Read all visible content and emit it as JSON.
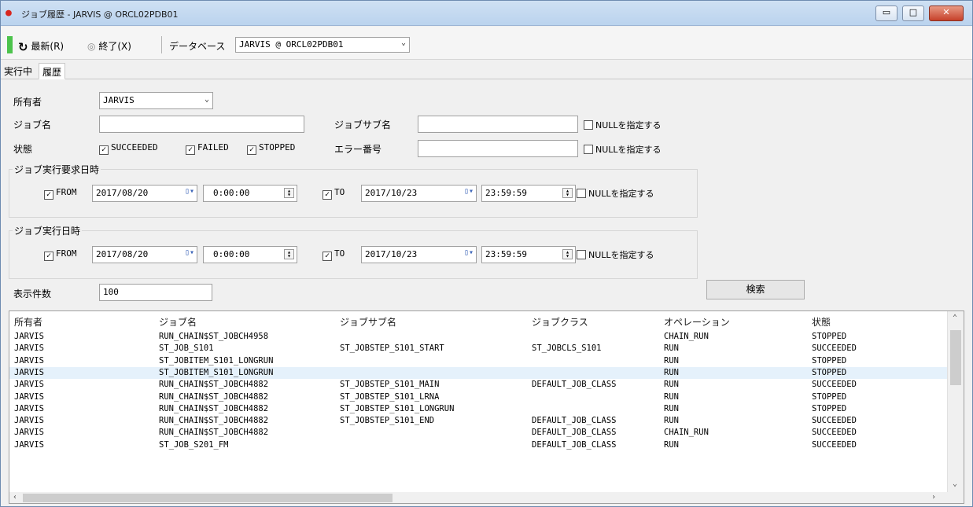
{
  "window": {
    "title": "ジョブ履歴 - JARVIS @ ORCL02PDB01",
    "min_label": "▭",
    "max_label": "□",
    "close_label": "✕"
  },
  "toolbar": {
    "refresh_label": "最新(R)",
    "exit_label": "終了(X)",
    "database_label": "データベース",
    "database_value": "JARVIS @ ORCL02PDB01"
  },
  "tabs": [
    "実行中",
    "履歴"
  ],
  "filters": {
    "owner_label": "所有者",
    "owner_value": "JARVIS",
    "job_name_label": "ジョブ名",
    "job_name_value": "",
    "job_subname_label": "ジョブサブ名",
    "job_subname_value": "",
    "null_label": "NULLを指定する",
    "status_label": "状態",
    "status_options": [
      {
        "label": "SUCCEEDED",
        "checked": true
      },
      {
        "label": "FAILED",
        "checked": true
      },
      {
        "label": "STOPPED",
        "checked": true
      }
    ],
    "error_no_label": "エラー番号",
    "error_no_value": "",
    "req_group_title": "ジョブ実行要求日時",
    "run_group_title": "ジョブ実行日時",
    "from_label": "FROM",
    "to_label": "TO",
    "req_from_date": "2017/08/20",
    "req_from_time": "0:00:00",
    "req_to_date": "2017/10/23",
    "req_to_time": "23:59:59",
    "run_from_date": "2017/08/20",
    "run_from_time": "0:00:00",
    "run_to_date": "2017/10/23",
    "run_to_time": "23:59:59",
    "count_label": "表示件数",
    "count_value": "100",
    "search_label": "検索"
  },
  "grid": {
    "columns": [
      "所有者",
      "ジョブ名",
      "ジョブサブ名",
      "ジョブクラス",
      "オペレーション",
      "状態"
    ],
    "rows": [
      [
        "JARVIS",
        "RUN_CHAIN$ST_JOBCH4958",
        "",
        "",
        "CHAIN_RUN",
        "STOPPED"
      ],
      [
        "JARVIS",
        "ST_JOB_S101",
        "ST_JOBSTEP_S101_START",
        "ST_JOBCLS_S101",
        "RUN",
        "SUCCEEDED"
      ],
      [
        "JARVIS",
        "ST_JOBITEM_S101_LONGRUN",
        "",
        "",
        "RUN",
        "STOPPED"
      ],
      [
        "JARVIS",
        "ST_JOBITEM_S101_LONGRUN",
        "",
        "",
        "RUN",
        "STOPPED"
      ],
      [
        "JARVIS",
        "RUN_CHAIN$ST_JOBCH4882",
        "ST_JOBSTEP_S101_MAIN",
        "DEFAULT_JOB_CLASS",
        "RUN",
        "SUCCEEDED"
      ],
      [
        "JARVIS",
        "RUN_CHAIN$ST_JOBCH4882",
        "ST_JOBSTEP_S101_LRNA",
        "",
        "RUN",
        "STOPPED"
      ],
      [
        "JARVIS",
        "RUN_CHAIN$ST_JOBCH4882",
        "ST_JOBSTEP_S101_LONGRUN",
        "",
        "RUN",
        "STOPPED"
      ],
      [
        "JARVIS",
        "RUN_CHAIN$ST_JOBCH4882",
        "ST_JOBSTEP_S101_END",
        "DEFAULT_JOB_CLASS",
        "RUN",
        "SUCCEEDED"
      ],
      [
        "JARVIS",
        "RUN_CHAIN$ST_JOBCH4882",
        "",
        "DEFAULT_JOB_CLASS",
        "CHAIN_RUN",
        "SUCCEEDED"
      ],
      [
        "JARVIS",
        "ST_JOB_S201_FM",
        "",
        "DEFAULT_JOB_CLASS",
        "RUN",
        "SUCCEEDED"
      ]
    ],
    "selected_row": 3
  },
  "colors": {
    "titlebar": "#bad3ee",
    "selected_row": "#e5f1fb",
    "accent_green": "#4cc34c"
  }
}
